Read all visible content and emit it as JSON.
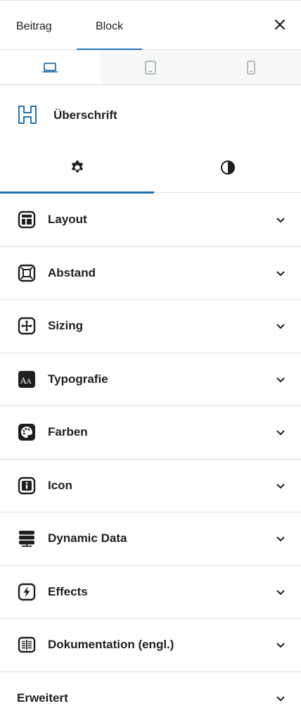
{
  "top_tabs": {
    "post": "Beitrag",
    "block": "Block"
  },
  "block": {
    "title": "Überschrift",
    "icon": "heading-icon"
  },
  "devices": [
    {
      "name": "desktop-icon",
      "selected": true
    },
    {
      "name": "tablet-icon",
      "selected": false
    },
    {
      "name": "mobile-icon",
      "selected": false
    }
  ],
  "settings_tabs": [
    {
      "icon": "gear-icon",
      "active": true
    },
    {
      "icon": "contrast-icon",
      "active": false
    }
  ],
  "panels": [
    {
      "label": "Layout",
      "icon": "layout-icon"
    },
    {
      "label": "Abstand",
      "icon": "spacing-icon"
    },
    {
      "label": "Sizing",
      "icon": "sizing-icon"
    },
    {
      "label": "Typografie",
      "icon": "typography-icon"
    },
    {
      "label": "Farben",
      "icon": "palette-icon"
    },
    {
      "label": "Icon",
      "icon": "info-icon"
    },
    {
      "label": "Dynamic Data",
      "icon": "database-icon"
    },
    {
      "label": "Effects",
      "icon": "lightning-icon"
    },
    {
      "label": "Dokumentation (engl.)",
      "icon": "documentation-icon"
    },
    {
      "label": "Erweitert",
      "icon": ""
    }
  ],
  "colors": {
    "accent": "#2271b1",
    "text": "#1e1e1e",
    "border": "#e0e0e0"
  }
}
